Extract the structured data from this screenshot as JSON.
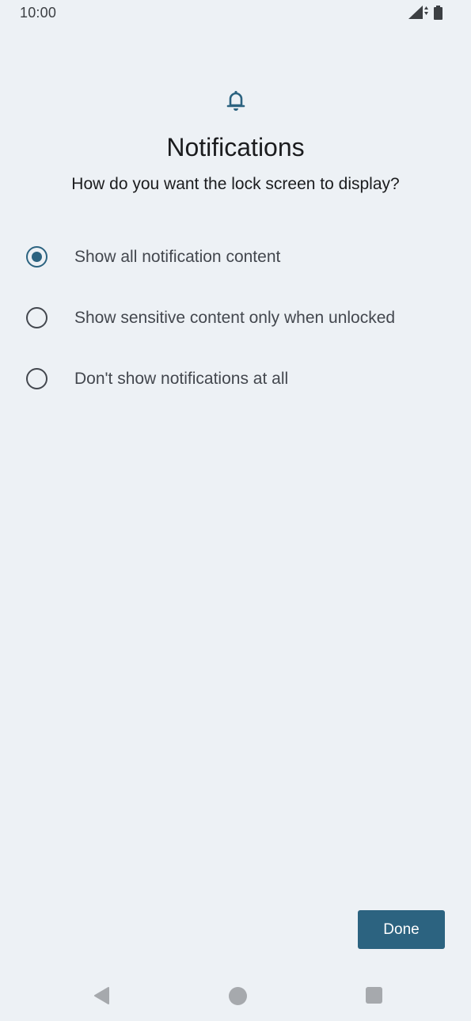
{
  "status_bar": {
    "time": "10:00",
    "signal_icon": "cell-signal-icon",
    "battery_icon": "battery-icon"
  },
  "header": {
    "icon": "bell-icon",
    "title": "Notifications",
    "subtitle": "How do you want the lock screen to display?"
  },
  "options": [
    {
      "label": "Show all notification content",
      "selected": true
    },
    {
      "label": "Show sensitive content only when unlocked",
      "selected": false
    },
    {
      "label": "Don't show notifications at all",
      "selected": false
    }
  ],
  "actions": {
    "done_label": "Done"
  },
  "nav": {
    "back_icon": "back-triangle-icon",
    "home_icon": "home-circle-icon",
    "recents_icon": "recents-square-icon"
  },
  "colors": {
    "background": "#edf1f5",
    "accent": "#2c6380",
    "text_primary": "#1b1c1e",
    "text_secondary": "#43474e",
    "nav_icon": "#a6a9ad"
  }
}
